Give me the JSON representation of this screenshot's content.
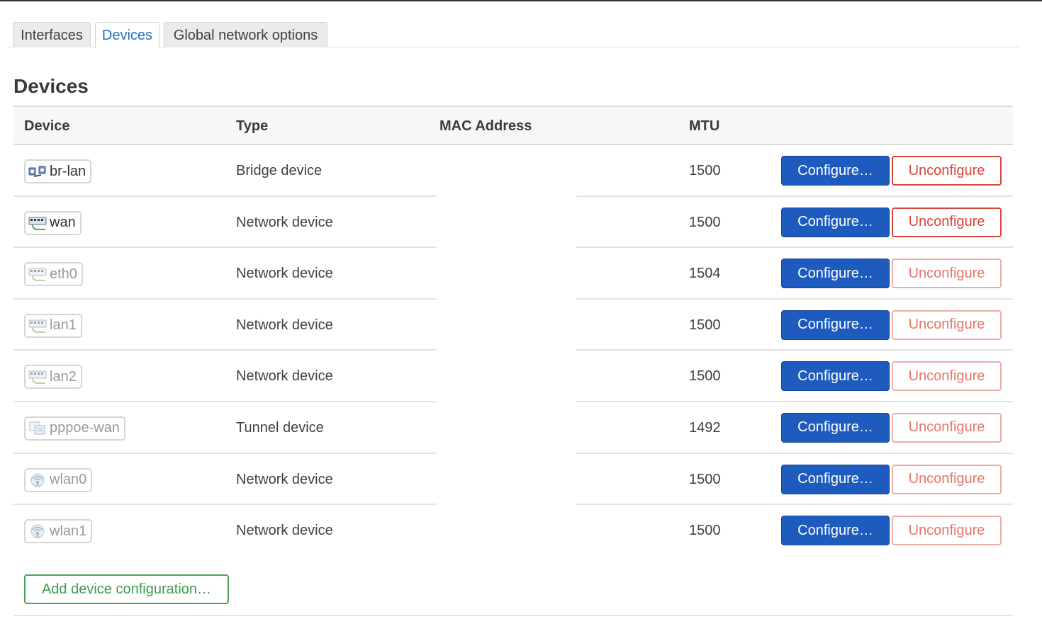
{
  "tabs": [
    {
      "label": "Interfaces",
      "active": false
    },
    {
      "label": "Devices",
      "active": true
    },
    {
      "label": "Global network options",
      "active": false
    }
  ],
  "section_title": "Devices",
  "columns": {
    "device": "Device",
    "type": "Type",
    "mac": "MAC Address",
    "mtu": "MTU"
  },
  "rows": [
    {
      "name": "br-lan",
      "icon": "bridge-icon",
      "state": "up",
      "type": "Bridge device",
      "mac": "",
      "mtu": "1500",
      "configure": "Configure…",
      "unconfigure": "Unconfigure",
      "unconfigure_enabled": true
    },
    {
      "name": "wan",
      "icon": "ethernet-icon",
      "state": "up",
      "type": "Network device",
      "mac": "",
      "mtu": "1500",
      "configure": "Configure…",
      "unconfigure": "Unconfigure",
      "unconfigure_enabled": true
    },
    {
      "name": "eth0",
      "icon": "ethernet-icon",
      "state": "down",
      "type": "Network device",
      "mac": "",
      "mtu": "1504",
      "configure": "Configure…",
      "unconfigure": "Unconfigure",
      "unconfigure_enabled": false
    },
    {
      "name": "lan1",
      "icon": "ethernet-icon",
      "state": "down",
      "type": "Network device",
      "mac": "",
      "mtu": "1500",
      "configure": "Configure…",
      "unconfigure": "Unconfigure",
      "unconfigure_enabled": false
    },
    {
      "name": "lan2",
      "icon": "ethernet-icon",
      "state": "down",
      "type": "Network device",
      "mac": "",
      "mtu": "1500",
      "configure": "Configure…",
      "unconfigure": "Unconfigure",
      "unconfigure_enabled": false
    },
    {
      "name": "pppoe-wan",
      "icon": "tunnel-icon",
      "state": "down",
      "type": "Tunnel device",
      "mac": "",
      "mtu": "1492",
      "configure": "Configure…",
      "unconfigure": "Unconfigure",
      "unconfigure_enabled": false
    },
    {
      "name": "wlan0",
      "icon": "wifi-icon",
      "state": "down",
      "type": "Network device",
      "mac": "",
      "mtu": "1500",
      "configure": "Configure…",
      "unconfigure": "Unconfigure",
      "unconfigure_enabled": false
    },
    {
      "name": "wlan1",
      "icon": "wifi-icon",
      "state": "down",
      "type": "Network device",
      "mac": "",
      "mtu": "1500",
      "configure": "Configure…",
      "unconfigure": "Unconfigure",
      "unconfigure_enabled": false
    }
  ],
  "add_button": "Add device configuration…",
  "colors": {
    "accent": "#1e5bbf",
    "danger": "#d8463a",
    "success": "#3c9a4d",
    "active_tab": "#1f6fc5"
  }
}
